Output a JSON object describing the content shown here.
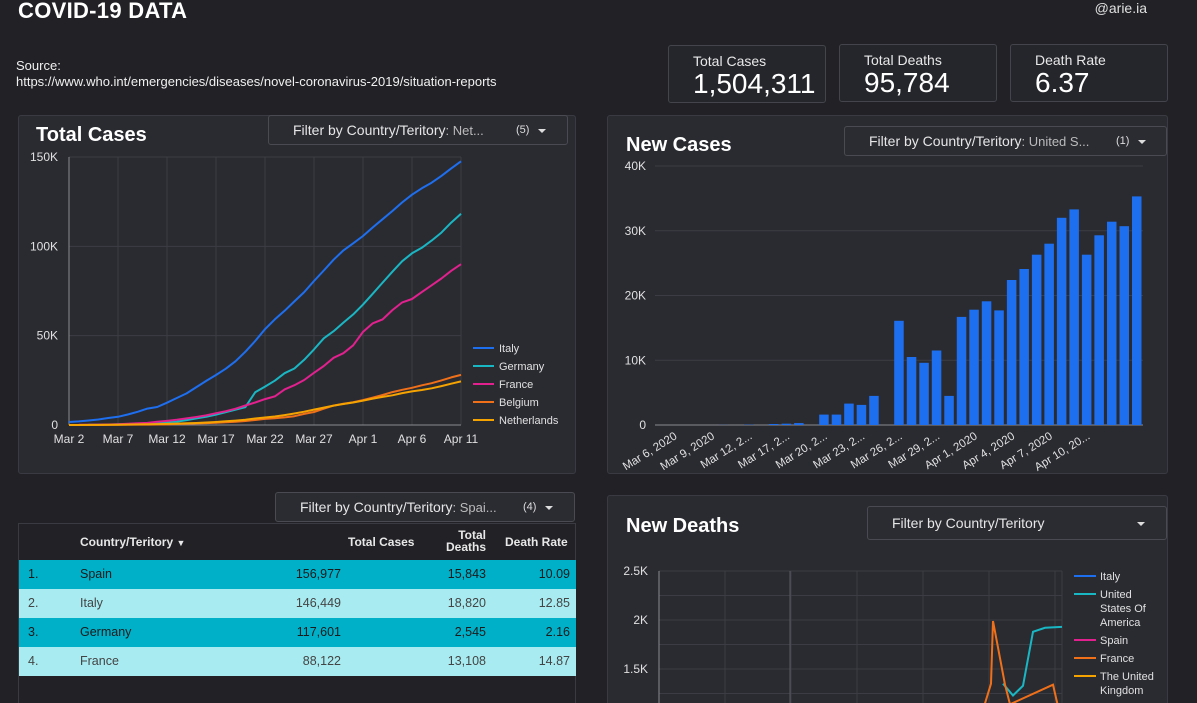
{
  "header": {
    "title": "COVID-19 DATA",
    "handle": "@arie.ia",
    "source_label": "Source:",
    "source_url": "https://www.who.int/emergencies/diseases/novel-coronavirus-2019/situation-reports"
  },
  "kpis": [
    {
      "label": "Total Cases",
      "value": "1,504,311"
    },
    {
      "label": "Total Deaths",
      "value": "95,784"
    },
    {
      "label": "Death Rate",
      "value": "6.37"
    }
  ],
  "total_cases": {
    "title": "Total Cases",
    "filter_label": "Filter by Country/Teritory",
    "filter_value": ": Net...",
    "filter_count": "(5)"
  },
  "new_cases": {
    "title": "New Cases",
    "filter_label": "Filter by Country/Teritory",
    "filter_value": ": United S...",
    "filter_count": "(1)"
  },
  "table_filter": {
    "filter_label": "Filter by Country/Teritory",
    "filter_value": ": Spai...",
    "filter_count": "(4)"
  },
  "table": {
    "headers": {
      "country": "Country/Teritory",
      "cases": "Total Cases",
      "deaths_line1": "Total",
      "deaths_line2": "Deaths",
      "rate": "Death Rate"
    },
    "rows": [
      {
        "idx": "1.",
        "country": "Spain",
        "cases": "156,977",
        "deaths": "15,843",
        "rate": "10.09"
      },
      {
        "idx": "2.",
        "country": "Italy",
        "cases": "146,449",
        "deaths": "18,820",
        "rate": "12.85"
      },
      {
        "idx": "3.",
        "country": "Germany",
        "cases": "117,601",
        "deaths": "2,545",
        "rate": "2.16"
      },
      {
        "idx": "4.",
        "country": "France",
        "cases": "88,122",
        "deaths": "13,108",
        "rate": "14.87"
      }
    ],
    "row_colors": [
      "#00b0c8",
      "#a8ecf2"
    ]
  },
  "new_deaths": {
    "title": "New Deaths",
    "filter_label": "Filter by Country/Teritory"
  },
  "chart_data": [
    {
      "type": "line",
      "x_ticks": [
        "Mar 2",
        "Mar 7",
        "Mar 12",
        "Mar 17",
        "Mar 22",
        "Mar 27",
        "Apr 1",
        "Apr 6",
        "Apr 11"
      ],
      "y_ticks": [
        "0",
        "50K",
        "100K",
        "150K"
      ],
      "ylim": [
        0,
        150000
      ],
      "legend_position": "right",
      "series": [
        {
          "name": "Italy",
          "color": "#1e6ff0",
          "values": [
            1700,
            2000,
            2500,
            3100,
            3900,
            4600,
            5900,
            7400,
            9200,
            10100,
            12500,
            15100,
            17700,
            21200,
            24700,
            27980,
            31500,
            35700,
            41000,
            47000,
            53600,
            59100,
            63900,
            69200,
            74400,
            80600,
            86500,
            92500,
            97700,
            101700,
            105800,
            110600,
            115200,
            119800,
            124600,
            128900,
            132500,
            135600,
            139400,
            143600,
            147600
          ]
        },
        {
          "name": "Germany",
          "color": "#19b7c4",
          "values": [
            150,
            180,
            240,
            400,
            540,
            640,
            800,
            1100,
            1600,
            1900,
            2750,
            3700,
            4600,
            5800,
            7200,
            8600,
            10000,
            18300,
            21500,
            24800,
            29000,
            31600,
            36500,
            42300,
            48500,
            52500,
            57300,
            61900,
            67400,
            73500,
            79700,
            85800,
            91700,
            96100,
            99200,
            103200,
            107700,
            113300,
            118200
          ]
        },
        {
          "name": "France",
          "color": "#e2208e",
          "values": [
            130,
            190,
            210,
            290,
            420,
            650,
            950,
            1200,
            1800,
            2300,
            2900,
            3700,
            4500,
            5400,
            6600,
            7700,
            9100,
            10900,
            12600,
            14500,
            16000,
            19900,
            22300,
            25200,
            29200,
            33000,
            37600,
            40200,
            44600,
            52100,
            56900,
            59100,
            64300,
            68600,
            70500,
            74400,
            78200,
            82000,
            86300,
            90000
          ]
        },
        {
          "name": "Belgium",
          "color": "#f0701a",
          "values": [
            8,
            13,
            23,
            50,
            109,
            169,
            200,
            239,
            267,
            314,
            559,
            689,
            886,
            1085,
            1243,
            1486,
            1795,
            2257,
            2815,
            3401,
            3743,
            4269,
            4937,
            6235,
            7284,
            9134,
            10836,
            11899,
            12775,
            13964,
            15348,
            16770,
            18431,
            19691,
            20814,
            22194,
            23403,
            24983,
            26667,
            28018
          ]
        },
        {
          "name": "Netherlands",
          "color": "#f5a300",
          "values": [
            18,
            24,
            38,
            82,
            128,
            188,
            265,
            321,
            382,
            503,
            614,
            804,
            959,
            1135,
            1413,
            1705,
            2051,
            2460,
            2994,
            3631,
            4204,
            4749,
            5560,
            6412,
            7431,
            8603,
            9762,
            10866,
            11750,
            12595,
            13614,
            14697,
            15723,
            16627,
            17851,
            18803,
            19580,
            20549,
            21762,
            23097,
            24413
          ]
        }
      ]
    },
    {
      "type": "bar",
      "x_ticks": [
        "Mar 6, 2020",
        "Mar 9, 2020",
        "Mar 12, 2...",
        "Mar 17, 2...",
        "Mar 20, 2...",
        "Mar 23, 2...",
        "Mar 26, 2...",
        "Mar 29, 2...",
        "Apr 1, 2020",
        "Apr 4, 2020",
        "Apr 7, 2020",
        "Apr 10, 20..."
      ],
      "y_ticks": [
        "0",
        "10K",
        "20K",
        "30K",
        "40K"
      ],
      "ylim": [
        0,
        40000
      ],
      "series": [
        {
          "name": "United S...",
          "color": "#1e6ff0",
          "values": [
            0,
            0,
            0,
            0,
            0,
            20,
            0,
            50,
            0,
            150,
            200,
            300,
            0,
            1600,
            1600,
            3300,
            3100,
            4500,
            0,
            16100,
            10500,
            9600,
            11500,
            4500,
            16700,
            17800,
            19100,
            17700,
            22400,
            24100,
            26300,
            28000,
            32000,
            33300,
            26300,
            29300,
            31400,
            30700,
            35300
          ]
        }
      ]
    },
    {
      "type": "line",
      "y_ticks": [
        "1.5K",
        "2K",
        "2.5K"
      ],
      "legend_position": "right",
      "series": [
        {
          "name": "Italy",
          "color": "#1e6ff0",
          "values": []
        },
        {
          "name": "United States Of America",
          "color": "#19b7c4",
          "values": [
            1350,
            1230,
            1330,
            1880,
            1920,
            1930
          ]
        },
        {
          "name": "Spain",
          "color": "#e2208e",
          "values": []
        },
        {
          "name": "France",
          "color": "#f0701a",
          "values": [
            1150,
            1350,
            1990,
            1340,
            1140,
            1340,
            1030
          ]
        },
        {
          "name": "The United Kingdom",
          "color": "#f5a300",
          "values": []
        }
      ]
    }
  ]
}
